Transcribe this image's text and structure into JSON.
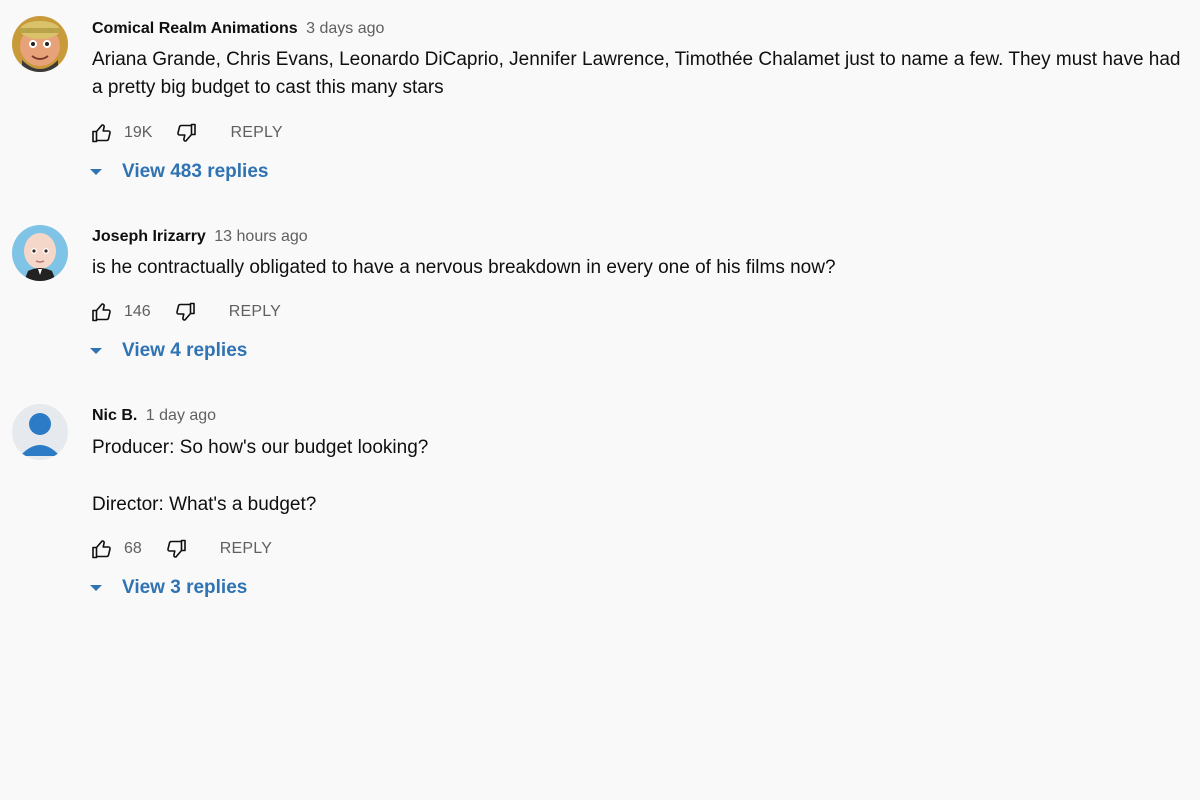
{
  "comments": [
    {
      "author": "Comical Realm Animations",
      "time": "3 days ago",
      "text_lines": [
        "Ariana Grande, Chris Evans, Leonardo DiCaprio, Jennifer Lawrence, Timothée Chalamet just to name a few. They must have had a pretty big budget to cast this many stars"
      ],
      "likes": "19K",
      "reply_label": "REPLY",
      "replies_label": "View 483 replies",
      "avatar_icon": "cartoon-avatar-icon"
    },
    {
      "author": "Joseph Irizarry",
      "time": "13 hours ago",
      "text_lines": [
        "is he contractually obligated to have a nervous breakdown in every one of his films now?"
      ],
      "likes": "146",
      "reply_label": "REPLY",
      "replies_label": "View 4 replies",
      "avatar_icon": "baby-avatar-icon"
    },
    {
      "author": "Nic B.",
      "time": "1 day ago",
      "text_lines": [
        "Producer: So how's our budget looking?",
        "Director: What's a budget?"
      ],
      "likes": "68",
      "reply_label": "REPLY",
      "replies_label": "View 3 replies",
      "avatar_icon": "default-user-avatar-icon"
    }
  ],
  "colors": {
    "background": "#f9f9f9",
    "link_blue": "#2f73b3",
    "secondary_text": "#606060",
    "primary_text": "#0f0f0f"
  }
}
